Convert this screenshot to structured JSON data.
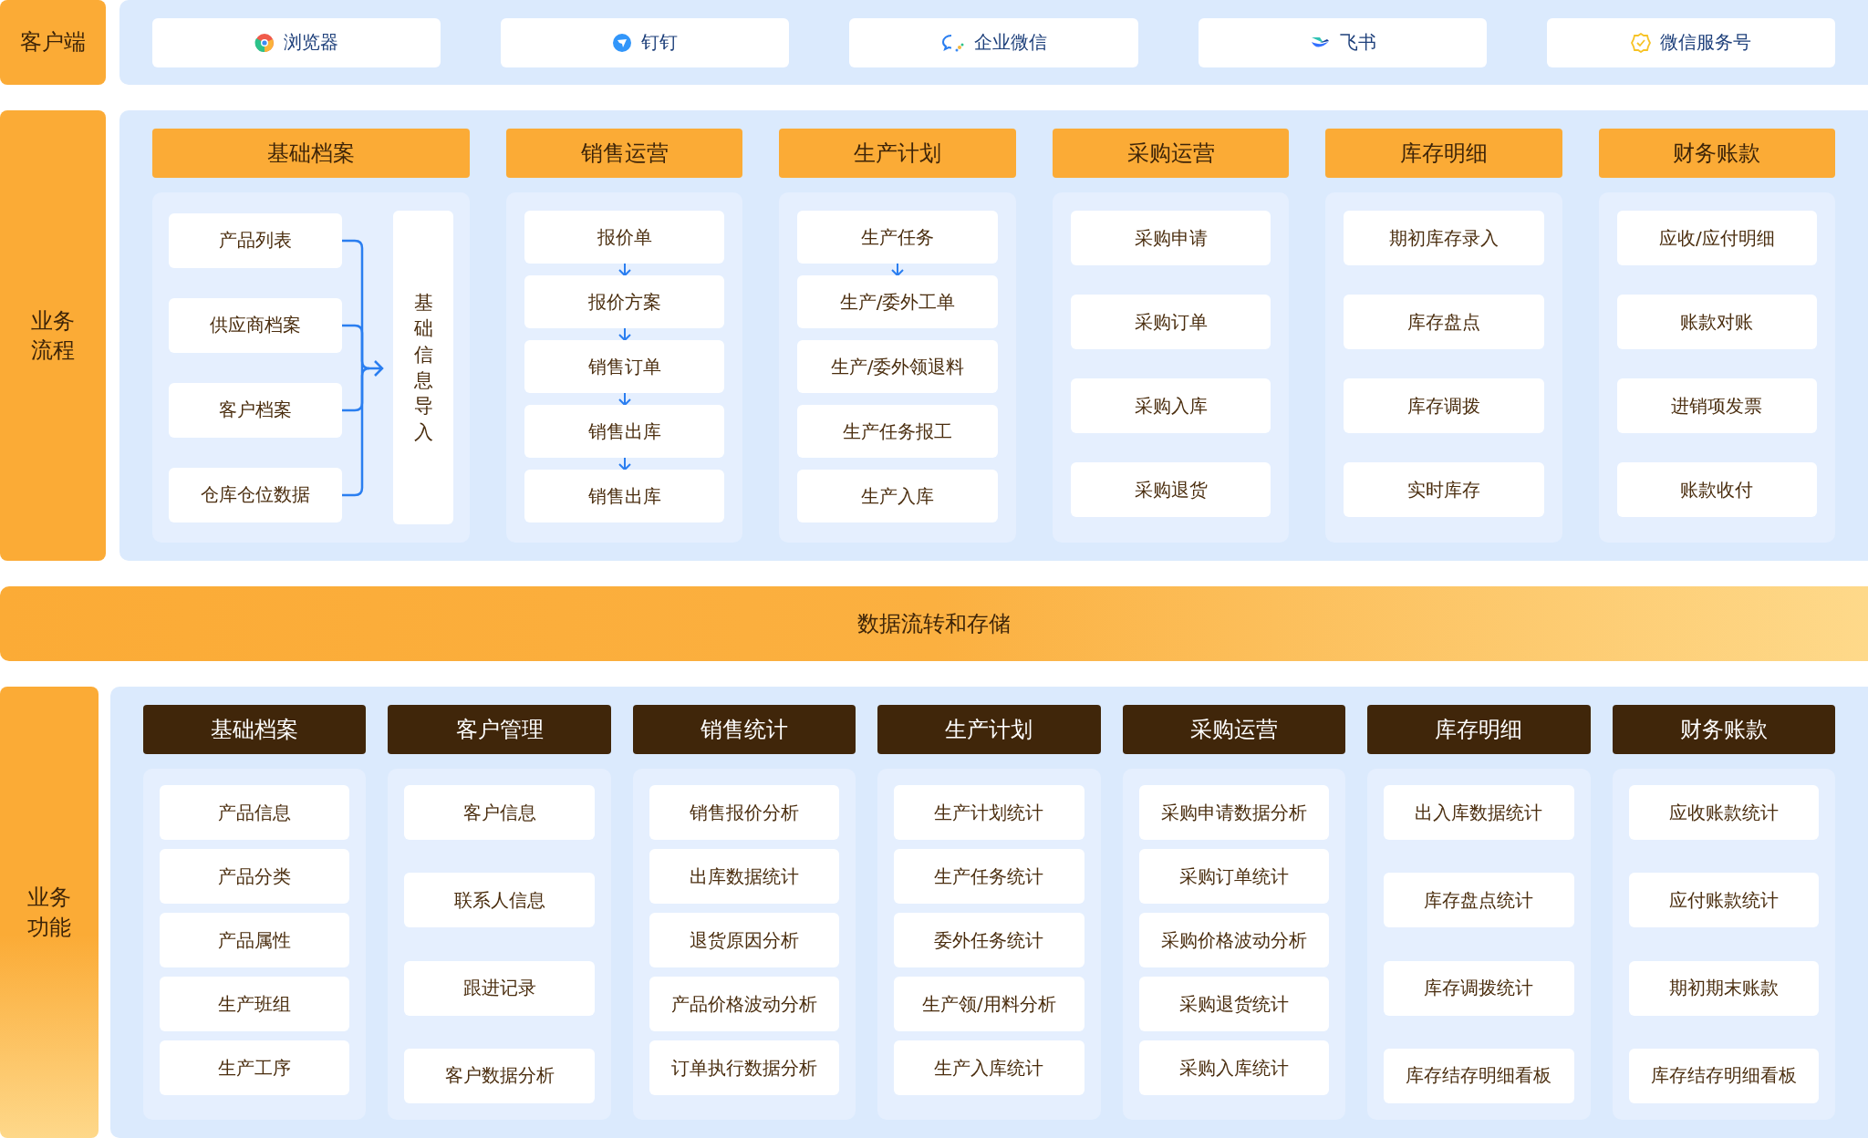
{
  "client": {
    "label": "客户端",
    "apps": [
      {
        "name": "浏览器"
      },
      {
        "name": "钉钉"
      },
      {
        "name": "企业微信"
      },
      {
        "name": "飞书"
      },
      {
        "name": "微信服务号"
      }
    ]
  },
  "process": {
    "label": "业务流程",
    "columns": [
      {
        "title": "基础档案",
        "kind": "import",
        "target": "基础信息导入",
        "items": [
          {
            "label": "产品列表"
          },
          {
            "label": "供应商档案"
          },
          {
            "label": "客户档案"
          },
          {
            "label": "仓库仓位数据"
          }
        ]
      },
      {
        "title": "销售运营",
        "kind": "flow",
        "items": [
          {
            "label": "报价单",
            "arrow_below": true
          },
          {
            "label": "报价方案",
            "arrow_below": true
          },
          {
            "label": "销售订单",
            "arrow_below": true
          },
          {
            "label": "销售出库",
            "arrow_below": true
          },
          {
            "label": "销售出库",
            "arrow_below": false
          }
        ]
      },
      {
        "title": "生产计划",
        "kind": "flow",
        "items": [
          {
            "label": "生产任务",
            "arrow_below": true
          },
          {
            "label": "生产/委外工单",
            "arrow_below": false
          },
          {
            "label": "生产/委外领退料",
            "arrow_below": false
          },
          {
            "label": "生产任务报工",
            "arrow_below": false
          },
          {
            "label": "生产入库",
            "arrow_below": false
          }
        ]
      },
      {
        "title": "采购运营",
        "kind": "list",
        "items": [
          {
            "label": "采购申请"
          },
          {
            "label": "采购订单"
          },
          {
            "label": "采购入库"
          },
          {
            "label": "采购退货"
          }
        ]
      },
      {
        "title": "库存明细",
        "kind": "list",
        "items": [
          {
            "label": "期初库存录入"
          },
          {
            "label": "库存盘点"
          },
          {
            "label": "库存调拨"
          },
          {
            "label": "实时库存"
          }
        ]
      },
      {
        "title": "财务账款",
        "kind": "list",
        "items": [
          {
            "label": "应收/应付明细"
          },
          {
            "label": "账款对账"
          },
          {
            "label": "进销项发票"
          },
          {
            "label": "账款收付"
          }
        ]
      }
    ]
  },
  "data_bar": "数据流转和存储",
  "functions": {
    "label": "业务功能",
    "columns": [
      {
        "title": "基础档案",
        "items": [
          "产品信息",
          "产品分类",
          "产品属性",
          "生产班组",
          "生产工序"
        ]
      },
      {
        "title": "客户管理",
        "items": [
          "客户信息",
          "联系人信息",
          "跟进记录",
          "客户数据分析"
        ]
      },
      {
        "title": "销售统计",
        "items": [
          "销售报价分析",
          "出库数据统计",
          "退货原因分析",
          "产品价格波动分析",
          "订单执行数据分析"
        ]
      },
      {
        "title": "生产计划",
        "items": [
          "生产计划统计",
          "生产任务统计",
          "委外任务统计",
          "生产领/用料分析",
          "生产入库统计"
        ]
      },
      {
        "title": "采购运营",
        "items": [
          "采购申请数据分析",
          "采购订单统计",
          "采购价格波动分析",
          "采购退货统计",
          "采购入库统计"
        ]
      },
      {
        "title": "库存明细",
        "items": [
          "出入库数据统计",
          "库存盘点统计",
          "库存调拨统计",
          "库存结存明细看板"
        ]
      },
      {
        "title": "财务账款",
        "items": [
          "应收账款统计",
          "应付账款统计",
          "期初期末账款",
          "库存结存明细看板"
        ]
      }
    ]
  }
}
